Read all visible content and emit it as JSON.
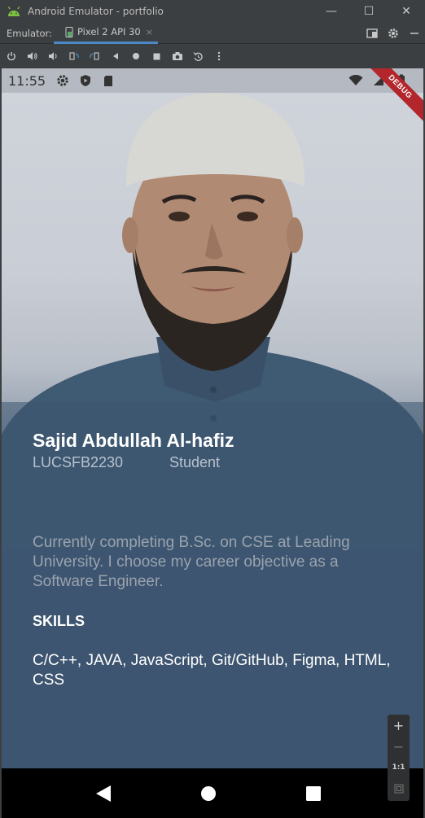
{
  "window": {
    "title": "Android Emulator - portfolio",
    "minimize": "—",
    "maximize": "☐",
    "close": "✕"
  },
  "tabbar": {
    "emulator_label": "Emulator:",
    "device_tab": "Pixel 2 API 30",
    "close": "×"
  },
  "status": {
    "time": "11:55"
  },
  "debug_banner": "DEBUG",
  "profile": {
    "name": "Sajid Abdullah Al-hafiz",
    "id": "LUCSFB2230",
    "role": "Student",
    "objective": "Currently completing B.Sc. on CSE at Leading University. I choose my career objective as a Software Engineer.",
    "skills_title": "SKILLS",
    "skills": "C/C++, JAVA, JavaScript, Git/GitHub, Figma, HTML, CSS"
  },
  "zoom": {
    "plus": "+",
    "minus": "−",
    "one_to_one": "1:1"
  },
  "colors": {
    "window_bg": "#3c3f41",
    "accent": "#4a88c7",
    "card_bg": "#3d5570",
    "ribbon": "#b3262b"
  }
}
